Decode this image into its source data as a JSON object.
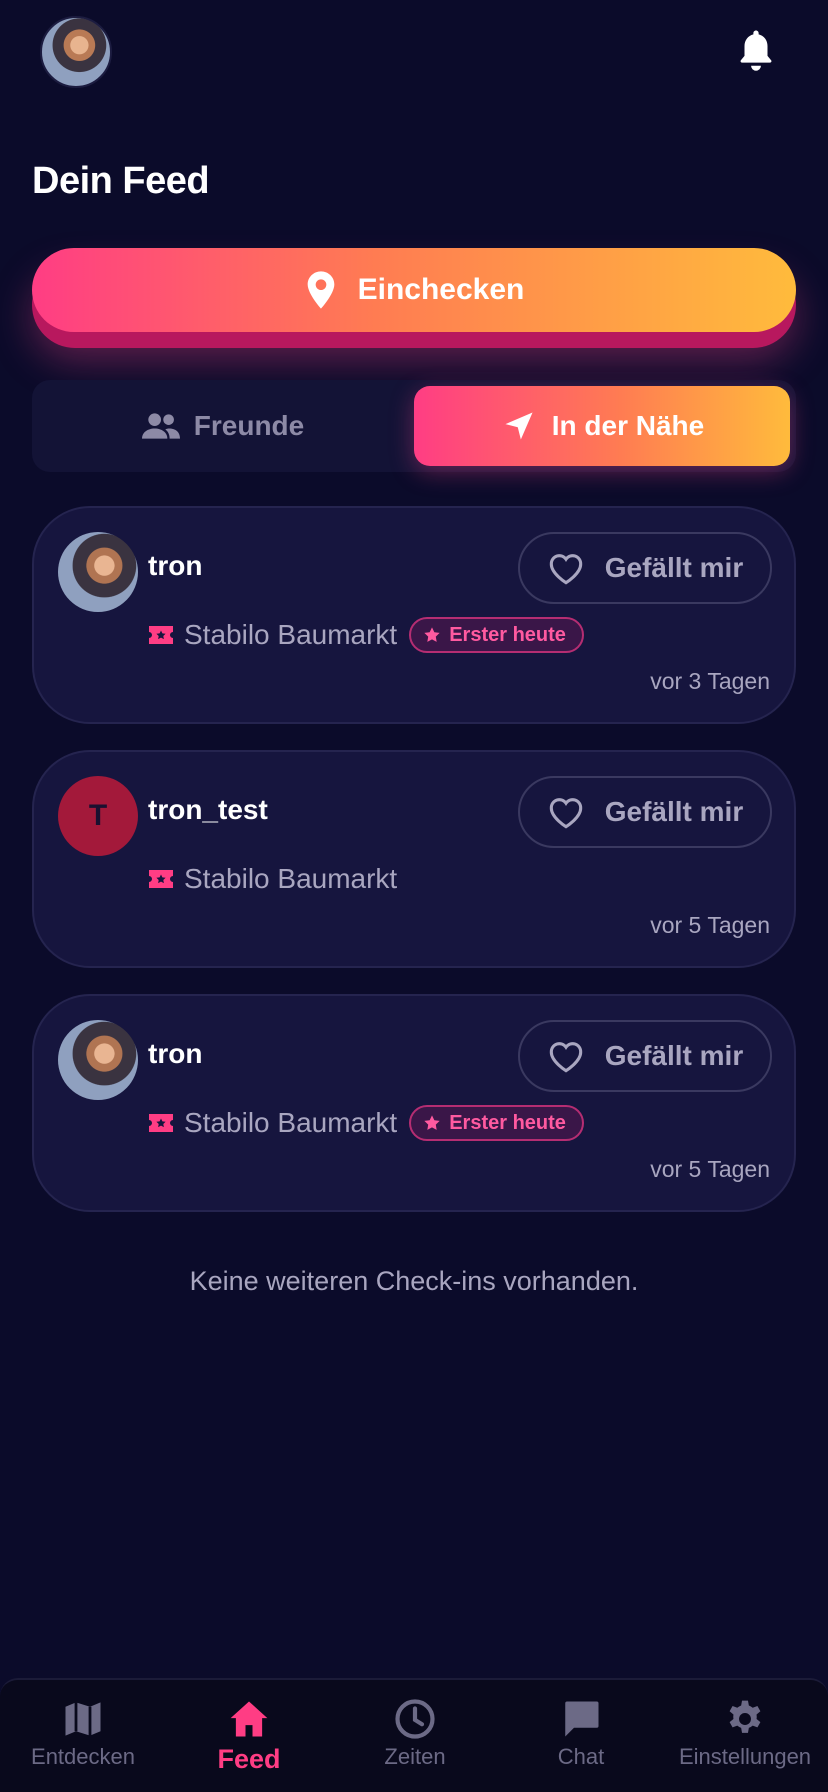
{
  "header": {
    "avatar_icon": "user-avatar",
    "bell_icon": "bell-icon",
    "title": "Dein Feed"
  },
  "checkin": {
    "label": "Einchecken",
    "icon": "location-pin-icon",
    "gradient_start": "#ff3d84",
    "gradient_end": "#ffbb3c"
  },
  "segment": {
    "friends_label": "Freunde",
    "nearby_label": "In der Nähe",
    "active": "nearby"
  },
  "feed": [
    {
      "user": "tron",
      "avatar_type": "photo",
      "avatar_letter": "",
      "place": "Stabilo Baumarkt",
      "badge": "Erster heute",
      "time": "vor 3 Tagen",
      "like_label": "Gefällt mir"
    },
    {
      "user": "tron_test",
      "avatar_type": "letter",
      "avatar_letter": "T",
      "place": "Stabilo Baumarkt",
      "badge": "",
      "time": "vor 5 Tagen",
      "like_label": "Gefällt mir"
    },
    {
      "user": "tron",
      "avatar_type": "photo",
      "avatar_letter": "",
      "place": "Stabilo Baumarkt",
      "badge": "Erster heute",
      "time": "vor 5 Tagen",
      "like_label": "Gefällt mir"
    }
  ],
  "end_note": "Keine weiteren Check-ins vorhanden.",
  "nav": {
    "items": [
      {
        "label": "Entdecken",
        "icon": "map-icon"
      },
      {
        "label": "Feed",
        "icon": "home-icon"
      },
      {
        "label": "Zeiten",
        "icon": "clock-icon"
      },
      {
        "label": "Chat",
        "icon": "chat-icon"
      },
      {
        "label": "Einstellungen",
        "icon": "gear-icon"
      }
    ],
    "active": "Feed",
    "active_color": "#ff3d84"
  }
}
